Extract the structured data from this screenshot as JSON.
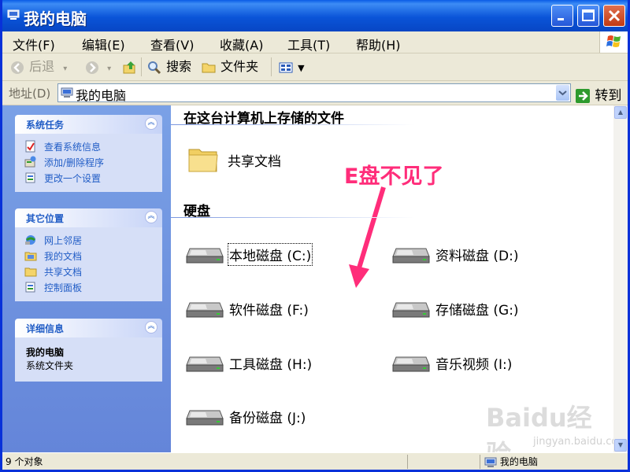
{
  "window": {
    "title": "我的电脑"
  },
  "menu": [
    "文件(F)",
    "编辑(E)",
    "查看(V)",
    "收藏(A)",
    "工具(T)",
    "帮助(H)"
  ],
  "toolbar": {
    "back": "后退",
    "search": "搜索",
    "folders": "文件夹"
  },
  "address": {
    "label": "地址(D)",
    "value": "我的电脑",
    "go": "转到"
  },
  "sidebar": {
    "tasks": {
      "title": "系统任务",
      "items": [
        "查看系统信息",
        "添加/删除程序",
        "更改一个设置"
      ]
    },
    "places": {
      "title": "其它位置",
      "items": [
        "网上邻居",
        "我的文档",
        "共享文档",
        "控制面板"
      ]
    },
    "details": {
      "title": "详细信息",
      "name": "我的电脑",
      "desc": "系统文件夹"
    }
  },
  "content": {
    "section_files": "在这台计算机上存储的文件",
    "shared_docs": "共享文档",
    "section_drives": "硬盘",
    "drives": [
      "本地磁盘 (C:)",
      "资料磁盘 (D:)",
      "软件磁盘 (F:)",
      "存储磁盘 (G:)",
      "工具磁盘 (H:)",
      "音乐视频 (I:)",
      "备份磁盘 (J:)"
    ],
    "annotation": "E盘不见了",
    "watermark": "Baidu经验",
    "watermark_url": "jingyan.baidu.com"
  },
  "status": {
    "count": "9 个对象",
    "location": "我的电脑"
  },
  "colors": {
    "annotation": "#ff2d7a",
    "titlebar": "#0a54d8",
    "sidebar": "#6f95e0"
  }
}
